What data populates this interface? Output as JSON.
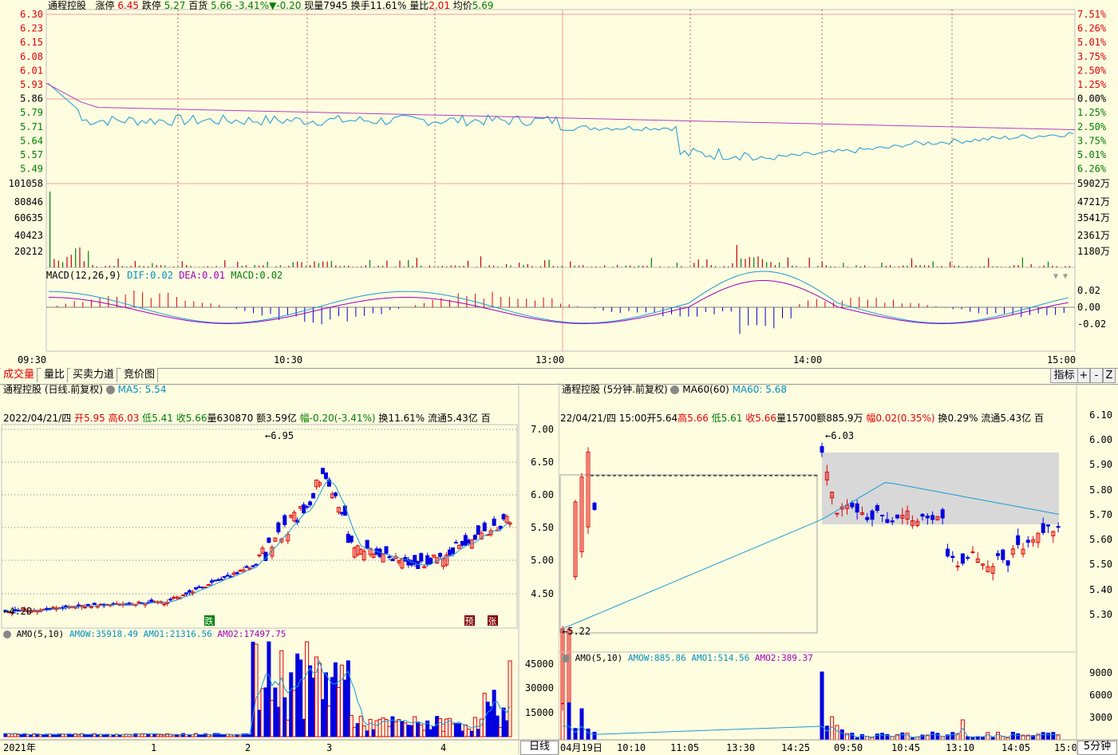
{
  "top_chart": {
    "stock_name": "通程控股",
    "limit_up_label": "涨停",
    "limit_up": "6.45",
    "limit_down_label": "跌停",
    "limit_down": "5.27",
    "price_label": "百货",
    "price": "5.66",
    "change_pct": "-3.41%",
    "change_icon": "triangle-down-icon",
    "change": "-0.20",
    "volume_label": "现量",
    "volume": "7945",
    "turnover_label": "换手",
    "turnover": "11.61%",
    "ratio_label": "量比",
    "ratio": "2.01",
    "avg_label": "均价",
    "avg": "5.69",
    "price_ticks": [
      "6.30",
      "6.23",
      "6.15",
      "6.08",
      "6.01",
      "5.93",
      "5.86",
      "5.79",
      "5.71",
      "5.64",
      "5.57",
      "5.49"
    ],
    "pct_ticks": [
      "7.51%",
      "6.26%",
      "5.01%",
      "3.75%",
      "2.50%",
      "1.25%",
      "0.00%",
      "1.25%",
      "2.50%",
      "3.75%",
      "5.01%",
      "6.26%"
    ],
    "vol_ticks": [
      "101058",
      "80846",
      "60635",
      "40423",
      "20212"
    ],
    "amt_ticks": [
      "5902万",
      "4721万",
      "3541万",
      "2361万",
      "1180万"
    ],
    "macd_label": "MACD(12,26,9)",
    "dif_label": "DIF:",
    "dif": "0.02",
    "dea_label": "DEA:",
    "dea": "0.01",
    "macd_name": "MACD:",
    "macd": "0.02",
    "macd_ticks": [
      "0.02",
      "0.00",
      "-0.02"
    ],
    "time_ticks": [
      "09:30",
      "10:30",
      "13:00",
      "14:00",
      "15:00"
    ]
  },
  "tabs": [
    "成交量",
    "量比",
    "买卖力道",
    "竞价图"
  ],
  "controls": {
    "indicator": "指标",
    "plus": "+",
    "minus": "-",
    "z": "Z"
  },
  "left_chart": {
    "title": "通程控股 (日线.前复权)",
    "ma_label": "MA5:",
    "ma_value": "5.54",
    "info_date": "2022/04/21/四",
    "open_label": "开",
    "open": "5.95",
    "high_label": "高",
    "high": "6.03",
    "low_label": "低",
    "low": "5.41",
    "close_label": "收",
    "close": "5.66",
    "vol_label": "量",
    "vol": "630870",
    "amt_label": "额",
    "amt": "3.59亿",
    "range_label": "幅",
    "range": "-0.20(-3.41%)",
    "turn_label": "换",
    "turn": "11.61%",
    "float_label": "流通",
    "float": "5.43亿",
    "extra": "百",
    "y_ticks": [
      "7.00",
      "6.50",
      "6.00",
      "5.50",
      "5.00",
      "4.50"
    ],
    "max_marker": "6.95",
    "min_marker": "4.20",
    "events": [
      "跌",
      "预",
      "张"
    ],
    "amo_label": "AMO(5,10)",
    "amow_label": "AMOW:",
    "amow": "35918.49",
    "amo1_label": "AMO1:",
    "amo1": "21316.56",
    "amo2_label": "AMO2:",
    "amo2": "17497.75",
    "amo_ticks": [
      "45000",
      "30000",
      "15000"
    ],
    "x_ticks": [
      "2021年",
      "1",
      "2",
      "3",
      "4"
    ],
    "period_button": "日线"
  },
  "right_chart": {
    "title": "通程控股 (5分钟.前复权)",
    "ma_label": "MA60(60)",
    "ma_name": "MA60:",
    "ma_value": "5.68",
    "info_date": "22/04/21/四",
    "info_time": "15:00",
    "open_label": "开",
    "open": "5.64",
    "high_label": "高",
    "high": "5.66",
    "low_label": "低",
    "low": "5.61",
    "close_label": "收",
    "close": "5.66",
    "vol_label": "量",
    "vol": "15700",
    "amt_label": "额",
    "amt": "885.9万",
    "range_label": "幅",
    "range": "0.02(0.35%)",
    "turn_label": "换",
    "turn": "0.29%",
    "float_label": "流通",
    "float": "5.43亿",
    "extra": "百",
    "y_ticks": [
      "6.10",
      "6.00",
      "5.90",
      "5.80",
      "5.70",
      "5.60",
      "5.50",
      "5.40",
      "5.30"
    ],
    "max_marker": "6.03",
    "min_marker": "5.22",
    "amo_label": "AMO(5,10)",
    "amow_label": "AMOW:",
    "amow": "885.86",
    "amo1_label": "AMO1:",
    "amo1": "514.56",
    "amo2_label": "AMO2:",
    "amo2": "389.37",
    "amo_ticks": [
      "9000",
      "6000",
      "3000"
    ],
    "x_ticks": [
      "04月19日",
      "10:10",
      "11:05",
      "13:30",
      "14:25",
      "09:50",
      "10:45",
      "13:10",
      "14:05",
      "15:0"
    ],
    "period_button": "5分钟"
  },
  "colors": {
    "up": "#e00000",
    "down": "#0000e0",
    "price_line": "#1a9ad6",
    "avg_line": "#b040c0",
    "grid": "#e8a0a0"
  }
}
